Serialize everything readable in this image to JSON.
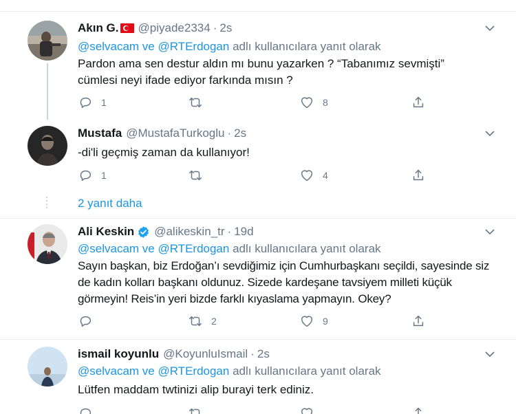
{
  "tweets": [
    {
      "name": "Akın G.",
      "handle": "@piyade2334",
      "time": "2s",
      "reply_mentions": "@selvacam ve @RTErdogan",
      "reply_suffix": " adlı kullanıcılara yanıt olarak",
      "text": "Pardon ama sen destur aldın mı bunu yazarken ? “Tabanımız sevmişti” cümlesi neyi ifade ediyor farkında mısın ?",
      "reply_count": "1",
      "retweet_count": "",
      "like_count": "8"
    },
    {
      "name": "Mustafa",
      "handle": "@MustafaTurkoglu",
      "time": "2s",
      "text": "-di'li geçmiş zaman da kullanıyor!",
      "reply_count": "1",
      "retweet_count": "",
      "like_count": "4"
    },
    {
      "name": "Ali Keskin",
      "handle": "@alikeskin_tr",
      "time": "19d",
      "reply_mentions": "@selvacam ve @RTErdogan",
      "reply_suffix": " adlı kullanıcılara yanıt olarak",
      "text": "Sayın başkan, biz Erdoğan’ı sevdiğimiz için Cumhurbaşkanı seçildi, sayesinde siz de kadın kolları başkanı oldunuz. Sizede kardeşane tavsiyem milleti küçük görmeyin! Reis’in yeri bizde farklı kıyaslama yapmayın. Okey?",
      "reply_count": "",
      "retweet_count": "2",
      "like_count": "9"
    },
    {
      "name": "ismail koyunlu",
      "handle": "@KoyunluIsmail",
      "time": "2s",
      "reply_mentions": "@selvacam ve @RTErdogan",
      "reply_suffix": " adlı kullanıcılara yanıt olarak",
      "text": "Lütfen maddam twtinizi alip burayi terk ediniz."
    }
  ],
  "more_replies_label": "2 yanıt daha",
  "icons": {
    "reply": "reply-icon",
    "retweet": "retweet-icon",
    "like": "heart-icon",
    "share": "share-icon",
    "menu": "chevron-down-icon",
    "verified": "verified-badge-icon",
    "flag": "turkey-flag-emoji"
  },
  "colors": {
    "link": "#1b95e0",
    "muted": "#657786",
    "text": "#14171a",
    "border": "#e6ecf0",
    "verified": "#1da1f2"
  }
}
